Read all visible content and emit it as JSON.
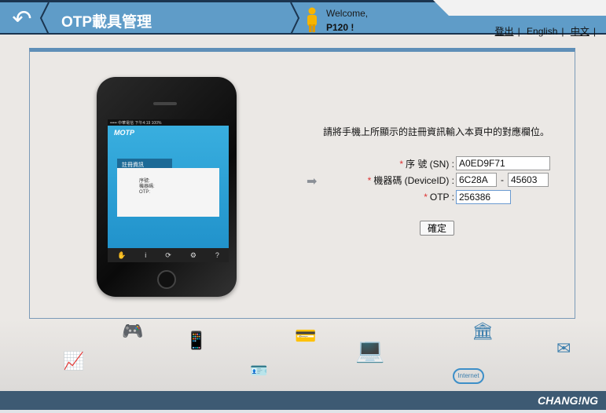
{
  "header": {
    "title": "OTP載具管理",
    "welcome": "Welcome,",
    "user": "P120 !",
    "links": [
      "登出",
      "English",
      "中文"
    ],
    "separator": "|"
  },
  "phone": {
    "status": "••••• 中華電信  下午4:19  100%",
    "app_logo": "MOTP",
    "tab": "註冊資訊",
    "card": [
      "序號:",
      "機器碼:",
      "OTP:"
    ],
    "tabbar": [
      "✋",
      "i",
      "⟳",
      "⚙",
      "?"
    ]
  },
  "form": {
    "instruction": "請將手機上所顯示的註冊資訊輸入本頁中的對應欄位。",
    "required_mark": "*",
    "sn_label": "序 號 (SN) :",
    "sn_value": "A0ED9F71",
    "device_label": "機器碼 (DeviceID) :",
    "device_value1": "6C28A",
    "device_dash": "-",
    "device_value2": "45603",
    "otp_label": "OTP :",
    "otp_value": "256386",
    "confirm": "確定"
  },
  "decoration": {
    "internet": "Internet"
  },
  "footer": {
    "logo": "CHANG!NG"
  },
  "colors": {
    "header": "#5f9cc8",
    "header_border": "#1b3550",
    "footer": "#3d5a73",
    "required": "#dd3333"
  }
}
